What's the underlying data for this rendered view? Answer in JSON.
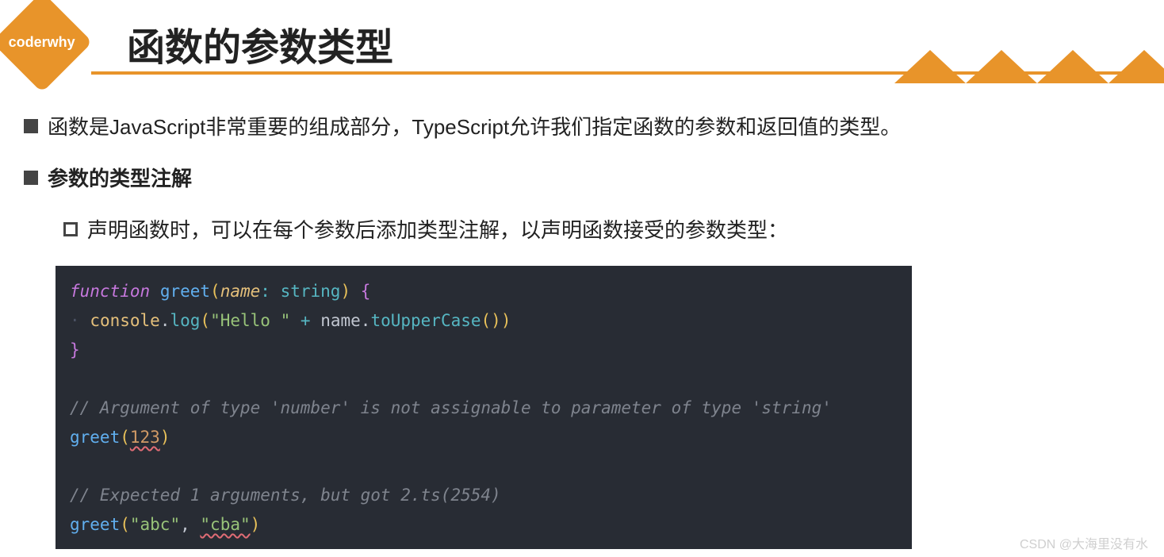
{
  "logo": {
    "text": "coderwhy"
  },
  "title": "函数的参数类型",
  "bullets": {
    "line1": "函数是JavaScript非常重要的组成部分，TypeScript允许我们指定函数的参数和返回值的类型。",
    "line2": "参数的类型注解",
    "line3": "声明函数时，可以在每个参数后添加类型注解，以声明函数接受的参数类型："
  },
  "code": {
    "kw_function": "function",
    "fn_greet": "greet",
    "param_name": "name",
    "type_string": "string",
    "obj_console": "console",
    "method_log": "log",
    "str_hello": "\"Hello \"",
    "var_name": "name",
    "method_upper": "toUpperCase",
    "comment1": "// Argument of type 'number' is not assignable to parameter of type 'string'",
    "call1_fn": "greet",
    "call1_arg": "123",
    "comment2": "// Expected 1 arguments, but got 2.ts(2554)",
    "call2_fn": "greet",
    "call2_arg1": "\"abc\"",
    "call2_arg2": "\"cba\"",
    "p_open": "(",
    "p_close": ")",
    "brace_open": "{",
    "brace_close": "}",
    "colon": ":",
    "plus": "+",
    "dot": ".",
    "comma": ",",
    "guide": "·"
  },
  "watermark": "CSDN @大海里没有水"
}
